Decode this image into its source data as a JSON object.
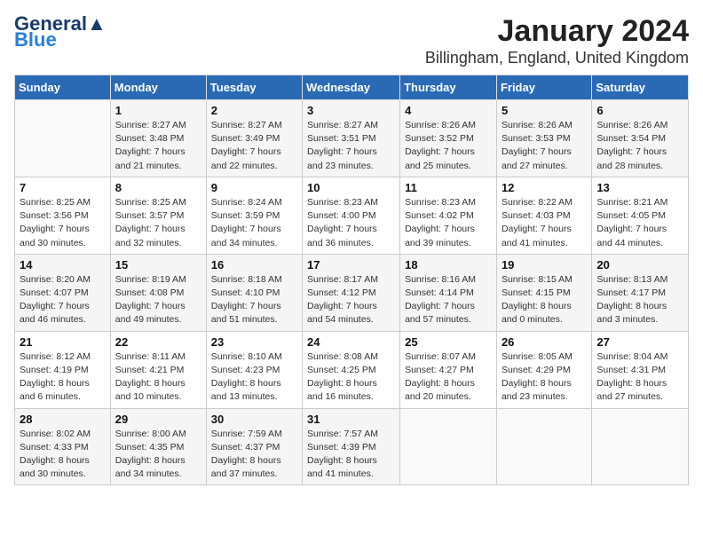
{
  "header": {
    "logo_line1": "General",
    "logo_line2": "Blue",
    "title": "January 2024",
    "subtitle": "Billingham, England, United Kingdom"
  },
  "days_of_week": [
    "Sunday",
    "Monday",
    "Tuesday",
    "Wednesday",
    "Thursday",
    "Friday",
    "Saturday"
  ],
  "weeks": [
    [
      {
        "day": "",
        "info": ""
      },
      {
        "day": "1",
        "info": "Sunrise: 8:27 AM\nSunset: 3:48 PM\nDaylight: 7 hours\nand 21 minutes."
      },
      {
        "day": "2",
        "info": "Sunrise: 8:27 AM\nSunset: 3:49 PM\nDaylight: 7 hours\nand 22 minutes."
      },
      {
        "day": "3",
        "info": "Sunrise: 8:27 AM\nSunset: 3:51 PM\nDaylight: 7 hours\nand 23 minutes."
      },
      {
        "day": "4",
        "info": "Sunrise: 8:26 AM\nSunset: 3:52 PM\nDaylight: 7 hours\nand 25 minutes."
      },
      {
        "day": "5",
        "info": "Sunrise: 8:26 AM\nSunset: 3:53 PM\nDaylight: 7 hours\nand 27 minutes."
      },
      {
        "day": "6",
        "info": "Sunrise: 8:26 AM\nSunset: 3:54 PM\nDaylight: 7 hours\nand 28 minutes."
      }
    ],
    [
      {
        "day": "7",
        "info": "Sunrise: 8:25 AM\nSunset: 3:56 PM\nDaylight: 7 hours\nand 30 minutes."
      },
      {
        "day": "8",
        "info": "Sunrise: 8:25 AM\nSunset: 3:57 PM\nDaylight: 7 hours\nand 32 minutes."
      },
      {
        "day": "9",
        "info": "Sunrise: 8:24 AM\nSunset: 3:59 PM\nDaylight: 7 hours\nand 34 minutes."
      },
      {
        "day": "10",
        "info": "Sunrise: 8:23 AM\nSunset: 4:00 PM\nDaylight: 7 hours\nand 36 minutes."
      },
      {
        "day": "11",
        "info": "Sunrise: 8:23 AM\nSunset: 4:02 PM\nDaylight: 7 hours\nand 39 minutes."
      },
      {
        "day": "12",
        "info": "Sunrise: 8:22 AM\nSunset: 4:03 PM\nDaylight: 7 hours\nand 41 minutes."
      },
      {
        "day": "13",
        "info": "Sunrise: 8:21 AM\nSunset: 4:05 PM\nDaylight: 7 hours\nand 44 minutes."
      }
    ],
    [
      {
        "day": "14",
        "info": "Sunrise: 8:20 AM\nSunset: 4:07 PM\nDaylight: 7 hours\nand 46 minutes."
      },
      {
        "day": "15",
        "info": "Sunrise: 8:19 AM\nSunset: 4:08 PM\nDaylight: 7 hours\nand 49 minutes."
      },
      {
        "day": "16",
        "info": "Sunrise: 8:18 AM\nSunset: 4:10 PM\nDaylight: 7 hours\nand 51 minutes."
      },
      {
        "day": "17",
        "info": "Sunrise: 8:17 AM\nSunset: 4:12 PM\nDaylight: 7 hours\nand 54 minutes."
      },
      {
        "day": "18",
        "info": "Sunrise: 8:16 AM\nSunset: 4:14 PM\nDaylight: 7 hours\nand 57 minutes."
      },
      {
        "day": "19",
        "info": "Sunrise: 8:15 AM\nSunset: 4:15 PM\nDaylight: 8 hours\nand 0 minutes."
      },
      {
        "day": "20",
        "info": "Sunrise: 8:13 AM\nSunset: 4:17 PM\nDaylight: 8 hours\nand 3 minutes."
      }
    ],
    [
      {
        "day": "21",
        "info": "Sunrise: 8:12 AM\nSunset: 4:19 PM\nDaylight: 8 hours\nand 6 minutes."
      },
      {
        "day": "22",
        "info": "Sunrise: 8:11 AM\nSunset: 4:21 PM\nDaylight: 8 hours\nand 10 minutes."
      },
      {
        "day": "23",
        "info": "Sunrise: 8:10 AM\nSunset: 4:23 PM\nDaylight: 8 hours\nand 13 minutes."
      },
      {
        "day": "24",
        "info": "Sunrise: 8:08 AM\nSunset: 4:25 PM\nDaylight: 8 hours\nand 16 minutes."
      },
      {
        "day": "25",
        "info": "Sunrise: 8:07 AM\nSunset: 4:27 PM\nDaylight: 8 hours\nand 20 minutes."
      },
      {
        "day": "26",
        "info": "Sunrise: 8:05 AM\nSunset: 4:29 PM\nDaylight: 8 hours\nand 23 minutes."
      },
      {
        "day": "27",
        "info": "Sunrise: 8:04 AM\nSunset: 4:31 PM\nDaylight: 8 hours\nand 27 minutes."
      }
    ],
    [
      {
        "day": "28",
        "info": "Sunrise: 8:02 AM\nSunset: 4:33 PM\nDaylight: 8 hours\nand 30 minutes."
      },
      {
        "day": "29",
        "info": "Sunrise: 8:00 AM\nSunset: 4:35 PM\nDaylight: 8 hours\nand 34 minutes."
      },
      {
        "day": "30",
        "info": "Sunrise: 7:59 AM\nSunset: 4:37 PM\nDaylight: 8 hours\nand 37 minutes."
      },
      {
        "day": "31",
        "info": "Sunrise: 7:57 AM\nSunset: 4:39 PM\nDaylight: 8 hours\nand 41 minutes."
      },
      {
        "day": "",
        "info": ""
      },
      {
        "day": "",
        "info": ""
      },
      {
        "day": "",
        "info": ""
      }
    ]
  ]
}
